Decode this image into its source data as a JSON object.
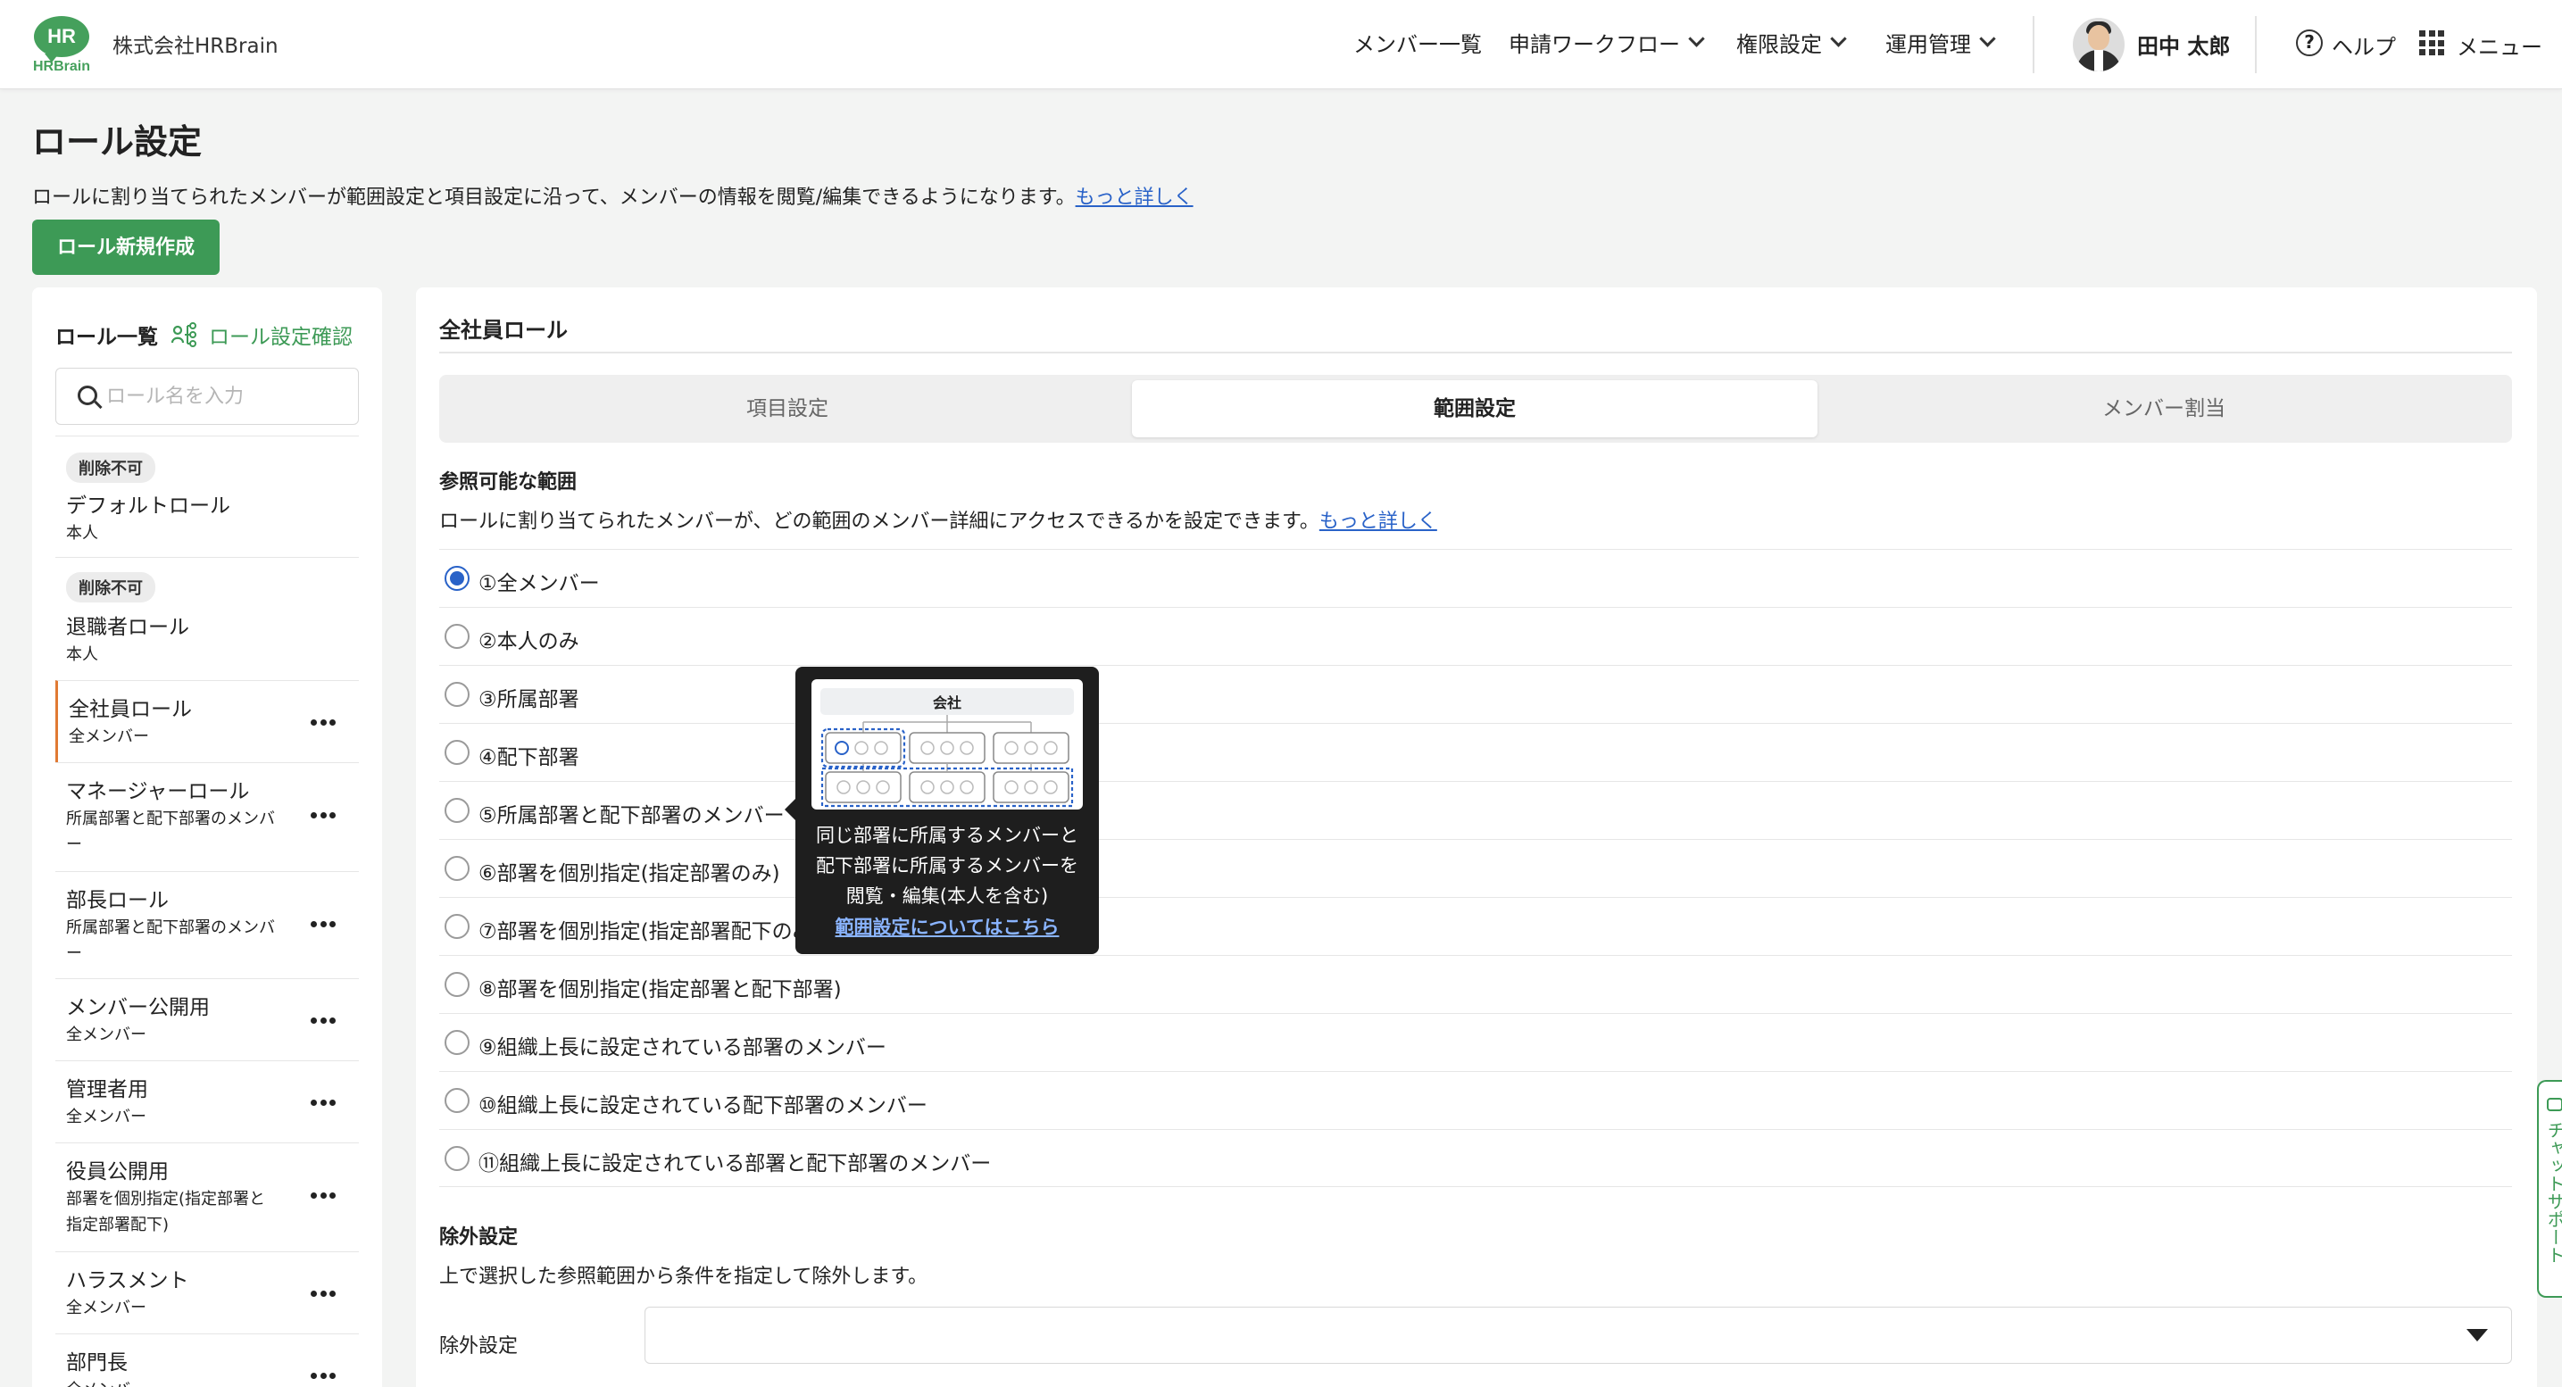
{
  "brand": {
    "logo_bubble": "HR",
    "logo_text": "HRBrain",
    "color": "#45a05c"
  },
  "header": {
    "company": "株式会社HRBrain",
    "nav": [
      {
        "label": "メンバー一覧"
      },
      {
        "label": "申請ワークフロー"
      },
      {
        "label": "権限設定"
      },
      {
        "label": "運用管理"
      }
    ],
    "user_name": "田中 太郎",
    "help_icon": "?",
    "help_label": "ヘルプ",
    "menu_label": "メニュー"
  },
  "page": {
    "title": "ロール設定",
    "description": "ロールに割り当てられたメンバーが範囲設定と項目設定に沿って、メンバーの情報を閲覧/編集できるようになります。",
    "more_link": "もっと詳しく",
    "create_button": "ロール新規作成"
  },
  "sidebar": {
    "title": "ロール一覧",
    "confirm_label": "ロール設定確認",
    "search_placeholder": "ロール名を入力",
    "roles": [
      {
        "badge": "削除不可",
        "name": "デフォルトロール",
        "sub": "本人",
        "menu": false,
        "active": false
      },
      {
        "badge": "削除不可",
        "name": "退職者ロール",
        "sub": "本人",
        "menu": false,
        "active": false
      },
      {
        "badge": "",
        "name": "全社員ロール",
        "sub": "全メンバー",
        "menu": true,
        "active": true
      },
      {
        "badge": "",
        "name": "マネージャーロール",
        "sub": "所属部署と配下部署のメンバー",
        "menu": true,
        "active": false
      },
      {
        "badge": "",
        "name": "部長ロール",
        "sub": "所属部署と配下部署のメンバー",
        "menu": true,
        "active": false
      },
      {
        "badge": "",
        "name": "メンバー公開用",
        "sub": "全メンバー",
        "menu": true,
        "active": false
      },
      {
        "badge": "",
        "name": "管理者用",
        "sub": "全メンバー",
        "menu": true,
        "active": false
      },
      {
        "badge": "",
        "name": "役員公開用",
        "sub": "部署を個別指定(指定部署と指定部署配下)",
        "menu": true,
        "active": false
      },
      {
        "badge": "",
        "name": "ハラスメント",
        "sub": "全メンバー",
        "menu": true,
        "active": false
      },
      {
        "badge": "",
        "name": "部門長",
        "sub": "全メンバー",
        "menu": true,
        "active": false
      }
    ]
  },
  "main": {
    "title": "全社員ロール",
    "tabs": [
      "項目設定",
      "範囲設定",
      "メンバー割当"
    ],
    "active_tab": 1,
    "scope_title": "参照可能な範囲",
    "scope_desc": "ロールに割り当てられたメンバーが、どの範囲のメンバー詳細にアクセスできるかを設定できます。",
    "scope_link": "もっと詳しく",
    "options": [
      "①全メンバー",
      "②本人のみ",
      "③所属部署",
      "④配下部署",
      "⑤所属部署と配下部署のメンバー",
      "⑥部署を個別指定(指定部署のみ)",
      "⑦部署を個別指定(指定部署配下のみ)",
      "⑧部署を個別指定(指定部署と配下部署)",
      "⑨組織上長に設定されている部署のメンバー",
      "⑩組織上長に設定されている配下部署のメンバー",
      "⑪組織上長に設定されている部署と配下部署のメンバー"
    ],
    "selected_option": 0,
    "exclusion_title": "除外設定",
    "exclusion_desc": "上で選択した参照範囲から条件を指定して除外します。",
    "exclusion_label": "除外設定",
    "exclusion_value": ""
  },
  "tooltip": {
    "diagram_label": "会社",
    "text_lines": [
      "同じ部署に所属するメンバーと",
      "配下部署に所属するメンバーを",
      "閲覧・編集(本人を含む)"
    ],
    "link": "範囲設定についてはこちら"
  },
  "chat": {
    "label": "チャットサポート"
  },
  "colors": {
    "accent_green": "#3d9a56",
    "link_blue": "#2962c8",
    "active_border": "#e07a34"
  }
}
